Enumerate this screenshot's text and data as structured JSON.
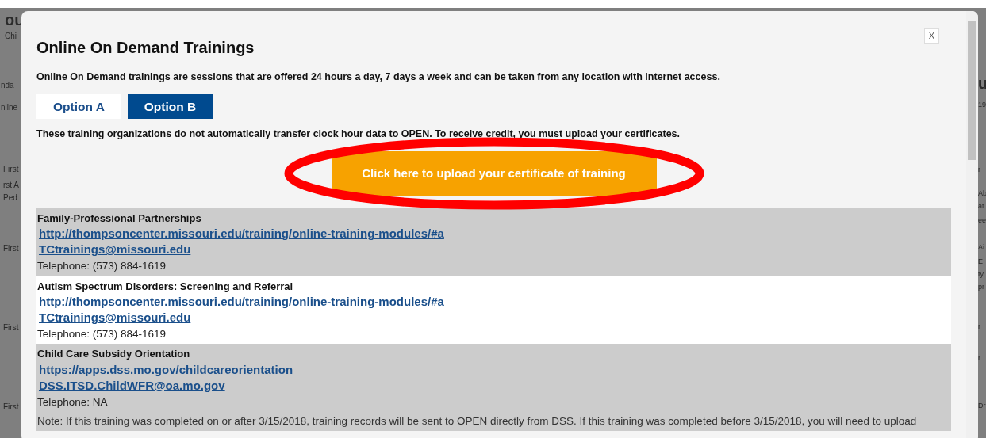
{
  "background": {
    "left_fragments": [
      "ou",
      "Chi",
      "nda",
      "nline",
      "First",
      "rst A",
      "Ped",
      "First",
      "First",
      "First"
    ],
    "right_fragments": [
      "u",
      "19",
      "r",
      "Ab",
      "at",
      "ee",
      "Ai",
      "E",
      "ty",
      "pr",
      "r",
      "r",
      "Dr"
    ]
  },
  "modal": {
    "title": "Online On Demand Trainings",
    "close_label": "X",
    "description": "Online On Demand trainings are sessions that are offered 24 hours a day, 7 days a week and can be taken from any location with internet access.",
    "tabs": [
      {
        "label": "Option A",
        "selected": false
      },
      {
        "label": "Option B",
        "selected": true
      }
    ],
    "notice": "These training organizations do not automatically transfer clock hour data to OPEN. To receive credit, you must upload your certificates.",
    "upload_button": "Click here to upload your certificate of training",
    "highlighted": true,
    "trainings": [
      {
        "title": "Family-Professional Partnerships",
        "url": "http://thompsoncenter.missouri.edu/training/online-training-modules/#a",
        "email": "TCtrainings@missouri.edu",
        "telephone": "Telephone: (573) 884-1619"
      },
      {
        "title": "Autism Spectrum Disorders: Screening and Referral",
        "url": "http://thompsoncenter.missouri.edu/training/online-training-modules/#a",
        "email": "TCtrainings@missouri.edu",
        "telephone": "Telephone: (573) 884-1619"
      },
      {
        "title": "Child Care Subsidy Orientation",
        "url": "https://apps.dss.mo.gov/childcareorientation",
        "email": "DSS.ITSD.ChildWFR@oa.mo.gov",
        "telephone": "Telephone: NA",
        "note": "Note: If this training was completed on or after 3/15/2018, training records will be sent to OPEN directly from DSS. If this training was completed before 3/15/2018, you will need to upload"
      }
    ]
  }
}
